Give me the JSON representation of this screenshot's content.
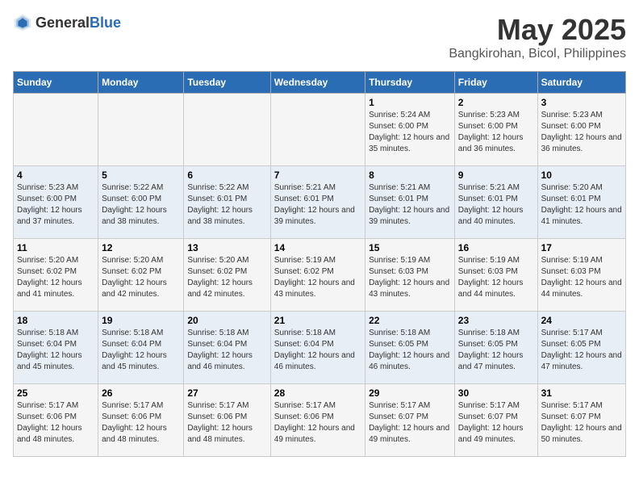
{
  "header": {
    "logo_general": "General",
    "logo_blue": "Blue",
    "title": "May 2025",
    "subtitle": "Bangkirohan, Bicol, Philippines"
  },
  "calendar": {
    "weekdays": [
      "Sunday",
      "Monday",
      "Tuesday",
      "Wednesday",
      "Thursday",
      "Friday",
      "Saturday"
    ],
    "weeks": [
      [
        {
          "day": "",
          "sunrise": "",
          "sunset": "",
          "daylight": ""
        },
        {
          "day": "",
          "sunrise": "",
          "sunset": "",
          "daylight": ""
        },
        {
          "day": "",
          "sunrise": "",
          "sunset": "",
          "daylight": ""
        },
        {
          "day": "",
          "sunrise": "",
          "sunset": "",
          "daylight": ""
        },
        {
          "day": "1",
          "sunrise": "Sunrise: 5:24 AM",
          "sunset": "Sunset: 6:00 PM",
          "daylight": "Daylight: 12 hours and 35 minutes."
        },
        {
          "day": "2",
          "sunrise": "Sunrise: 5:23 AM",
          "sunset": "Sunset: 6:00 PM",
          "daylight": "Daylight: 12 hours and 36 minutes."
        },
        {
          "day": "3",
          "sunrise": "Sunrise: 5:23 AM",
          "sunset": "Sunset: 6:00 PM",
          "daylight": "Daylight: 12 hours and 36 minutes."
        }
      ],
      [
        {
          "day": "4",
          "sunrise": "Sunrise: 5:23 AM",
          "sunset": "Sunset: 6:00 PM",
          "daylight": "Daylight: 12 hours and 37 minutes."
        },
        {
          "day": "5",
          "sunrise": "Sunrise: 5:22 AM",
          "sunset": "Sunset: 6:00 PM",
          "daylight": "Daylight: 12 hours and 38 minutes."
        },
        {
          "day": "6",
          "sunrise": "Sunrise: 5:22 AM",
          "sunset": "Sunset: 6:01 PM",
          "daylight": "Daylight: 12 hours and 38 minutes."
        },
        {
          "day": "7",
          "sunrise": "Sunrise: 5:21 AM",
          "sunset": "Sunset: 6:01 PM",
          "daylight": "Daylight: 12 hours and 39 minutes."
        },
        {
          "day": "8",
          "sunrise": "Sunrise: 5:21 AM",
          "sunset": "Sunset: 6:01 PM",
          "daylight": "Daylight: 12 hours and 39 minutes."
        },
        {
          "day": "9",
          "sunrise": "Sunrise: 5:21 AM",
          "sunset": "Sunset: 6:01 PM",
          "daylight": "Daylight: 12 hours and 40 minutes."
        },
        {
          "day": "10",
          "sunrise": "Sunrise: 5:20 AM",
          "sunset": "Sunset: 6:01 PM",
          "daylight": "Daylight: 12 hours and 41 minutes."
        }
      ],
      [
        {
          "day": "11",
          "sunrise": "Sunrise: 5:20 AM",
          "sunset": "Sunset: 6:02 PM",
          "daylight": "Daylight: 12 hours and 41 minutes."
        },
        {
          "day": "12",
          "sunrise": "Sunrise: 5:20 AM",
          "sunset": "Sunset: 6:02 PM",
          "daylight": "Daylight: 12 hours and 42 minutes."
        },
        {
          "day": "13",
          "sunrise": "Sunrise: 5:20 AM",
          "sunset": "Sunset: 6:02 PM",
          "daylight": "Daylight: 12 hours and 42 minutes."
        },
        {
          "day": "14",
          "sunrise": "Sunrise: 5:19 AM",
          "sunset": "Sunset: 6:02 PM",
          "daylight": "Daylight: 12 hours and 43 minutes."
        },
        {
          "day": "15",
          "sunrise": "Sunrise: 5:19 AM",
          "sunset": "Sunset: 6:03 PM",
          "daylight": "Daylight: 12 hours and 43 minutes."
        },
        {
          "day": "16",
          "sunrise": "Sunrise: 5:19 AM",
          "sunset": "Sunset: 6:03 PM",
          "daylight": "Daylight: 12 hours and 44 minutes."
        },
        {
          "day": "17",
          "sunrise": "Sunrise: 5:19 AM",
          "sunset": "Sunset: 6:03 PM",
          "daylight": "Daylight: 12 hours and 44 minutes."
        }
      ],
      [
        {
          "day": "18",
          "sunrise": "Sunrise: 5:18 AM",
          "sunset": "Sunset: 6:04 PM",
          "daylight": "Daylight: 12 hours and 45 minutes."
        },
        {
          "day": "19",
          "sunrise": "Sunrise: 5:18 AM",
          "sunset": "Sunset: 6:04 PM",
          "daylight": "Daylight: 12 hours and 45 minutes."
        },
        {
          "day": "20",
          "sunrise": "Sunrise: 5:18 AM",
          "sunset": "Sunset: 6:04 PM",
          "daylight": "Daylight: 12 hours and 46 minutes."
        },
        {
          "day": "21",
          "sunrise": "Sunrise: 5:18 AM",
          "sunset": "Sunset: 6:04 PM",
          "daylight": "Daylight: 12 hours and 46 minutes."
        },
        {
          "day": "22",
          "sunrise": "Sunrise: 5:18 AM",
          "sunset": "Sunset: 6:05 PM",
          "daylight": "Daylight: 12 hours and 46 minutes."
        },
        {
          "day": "23",
          "sunrise": "Sunrise: 5:18 AM",
          "sunset": "Sunset: 6:05 PM",
          "daylight": "Daylight: 12 hours and 47 minutes."
        },
        {
          "day": "24",
          "sunrise": "Sunrise: 5:17 AM",
          "sunset": "Sunset: 6:05 PM",
          "daylight": "Daylight: 12 hours and 47 minutes."
        }
      ],
      [
        {
          "day": "25",
          "sunrise": "Sunrise: 5:17 AM",
          "sunset": "Sunset: 6:06 PM",
          "daylight": "Daylight: 12 hours and 48 minutes."
        },
        {
          "day": "26",
          "sunrise": "Sunrise: 5:17 AM",
          "sunset": "Sunset: 6:06 PM",
          "daylight": "Daylight: 12 hours and 48 minutes."
        },
        {
          "day": "27",
          "sunrise": "Sunrise: 5:17 AM",
          "sunset": "Sunset: 6:06 PM",
          "daylight": "Daylight: 12 hours and 48 minutes."
        },
        {
          "day": "28",
          "sunrise": "Sunrise: 5:17 AM",
          "sunset": "Sunset: 6:06 PM",
          "daylight": "Daylight: 12 hours and 49 minutes."
        },
        {
          "day": "29",
          "sunrise": "Sunrise: 5:17 AM",
          "sunset": "Sunset: 6:07 PM",
          "daylight": "Daylight: 12 hours and 49 minutes."
        },
        {
          "day": "30",
          "sunrise": "Sunrise: 5:17 AM",
          "sunset": "Sunset: 6:07 PM",
          "daylight": "Daylight: 12 hours and 49 minutes."
        },
        {
          "day": "31",
          "sunrise": "Sunrise: 5:17 AM",
          "sunset": "Sunset: 6:07 PM",
          "daylight": "Daylight: 12 hours and 50 minutes."
        }
      ]
    ]
  }
}
